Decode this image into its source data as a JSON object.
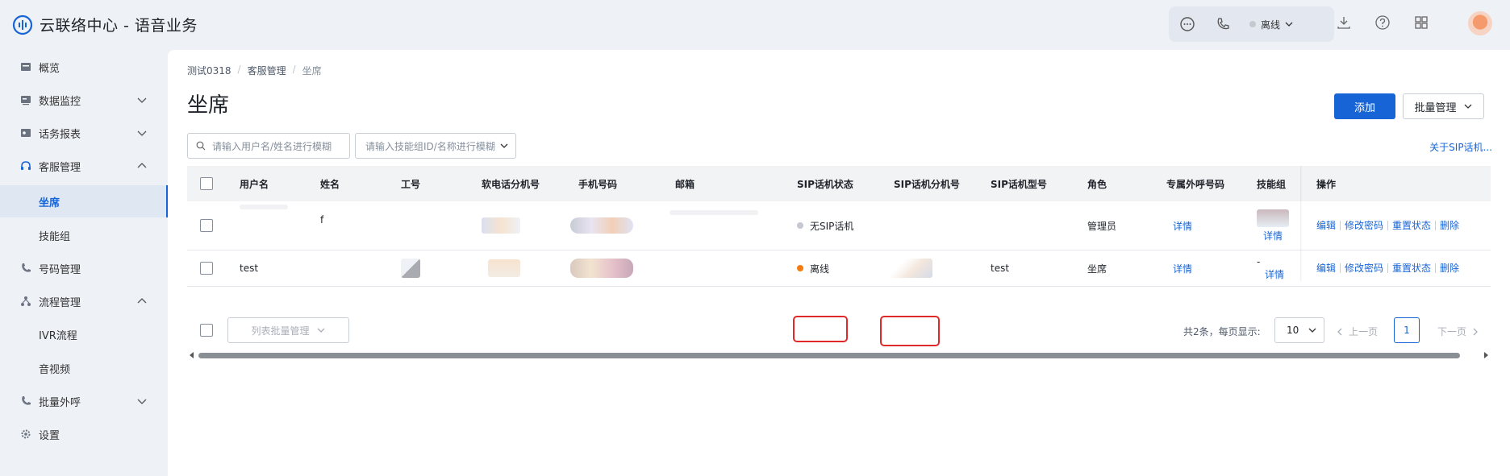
{
  "app": {
    "title": "云联络中心 - 语音业务"
  },
  "topbar": {
    "status_label": "离线"
  },
  "sidebar": {
    "items": [
      {
        "label": "概览",
        "icon": "overview-icon"
      },
      {
        "label": "数据监控",
        "icon": "monitor-icon"
      },
      {
        "label": "话务报表",
        "icon": "report-icon"
      },
      {
        "label": "客服管理",
        "icon": "headset-icon"
      },
      {
        "label": "坐席"
      },
      {
        "label": "技能组"
      },
      {
        "label": "号码管理",
        "icon": "phone-icon"
      },
      {
        "label": "流程管理",
        "icon": "flow-icon"
      },
      {
        "label": "IVR流程"
      },
      {
        "label": "音视频"
      },
      {
        "label": "批量外呼",
        "icon": "outbound-icon"
      },
      {
        "label": "设置",
        "icon": "gear-icon"
      }
    ]
  },
  "breadcrumb": [
    "测试0318",
    "客服管理",
    "坐席"
  ],
  "page": {
    "title": "坐席",
    "add_label": "添加",
    "batch_label": "批量管理",
    "sip_link": "关于SIP话机..."
  },
  "filters": {
    "user_placeholder": "请输入用户名/姓名进行模糊",
    "skill_placeholder": "请输入技能组ID/名称进行模糊"
  },
  "table": {
    "columns": [
      "用户名",
      "姓名",
      "工号",
      "软电话分机号",
      "手机号码",
      "邮箱",
      "SIP话机状态",
      "SIP话机分机号",
      "SIP话机型号",
      "角色",
      "专属外呼号码",
      "技能组",
      "操作"
    ],
    "rows": [
      {
        "username": "",
        "name": "f",
        "sip_status": "无SIP话机",
        "sip_model": "",
        "role": "管理员",
        "outbound": "详情",
        "skill": "详情",
        "skill_prefix": ""
      },
      {
        "username": "test",
        "name": "",
        "sip_status": "离线",
        "sip_model": "test",
        "role": "坐席",
        "outbound": "详情",
        "skill": "详情",
        "skill_prefix": "-"
      }
    ],
    "ops": [
      "编辑",
      "修改密码",
      "重置状态",
      "删除"
    ]
  },
  "footer": {
    "batch_list_label": "列表批量管理",
    "total_text": "共2条，每页显示:",
    "page_size": "10",
    "prev_label": "上一页",
    "current_page": "1",
    "next_label": "下一页"
  },
  "colors": {
    "accent": "#1764d6",
    "offline": "#f77b0f",
    "highlight": "#e02a2a"
  }
}
